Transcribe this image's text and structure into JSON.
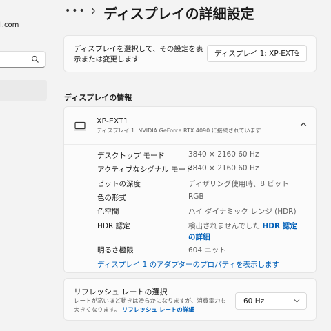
{
  "sidebar": {
    "account_email": "l.com"
  },
  "header": {
    "more": "•••",
    "title": "ディスプレイの詳細設定"
  },
  "display_select": {
    "description": "ディスプレイを選択して、その設定を表示または変更します",
    "selected": "ディスプレイ 1: XP-EXT1"
  },
  "info": {
    "section_title": "ディスプレイの情報",
    "monitor_name": "XP-EXT1",
    "monitor_subtitle": "ディスプレイ 1: NVIDIA GeForce RTX 4090 に接続されています",
    "rows": [
      {
        "label": "デスクトップ モード",
        "value": "3840 × 2160 60 Hz"
      },
      {
        "label": "アクティブなシグナル モード",
        "value": "3840 × 2160 60 Hz"
      },
      {
        "label": "ビットの深度",
        "value": "ディザリング使用時、8 ビット"
      },
      {
        "label": "色の形式",
        "value": "RGB"
      },
      {
        "label": "色空間",
        "value": "ハイ ダイナミック レンジ (HDR)"
      },
      {
        "label": "HDR 認定",
        "value": "検出されませんでした",
        "link": "HDR 認定の詳細"
      },
      {
        "label": "明るさ極限",
        "value": "604 ニット"
      }
    ],
    "adapter_link": "ディスプレイ 1 のアダプターのプロパティを表示します"
  },
  "refresh": {
    "title": "リフレッシュ レートの選択",
    "description": "レートが高いほど動きは滑らかになりますが、消費電力も大きくなります。",
    "link": "リフレッシュ レートの詳細",
    "selected": "60 Hz"
  },
  "icons": {
    "search": "search-icon",
    "monitor": "monitor-icon",
    "chevron_down": "chevron-down-icon",
    "chevron_up": "chevron-up-icon",
    "breadcrumb_chevron": "chevron-right-icon"
  }
}
